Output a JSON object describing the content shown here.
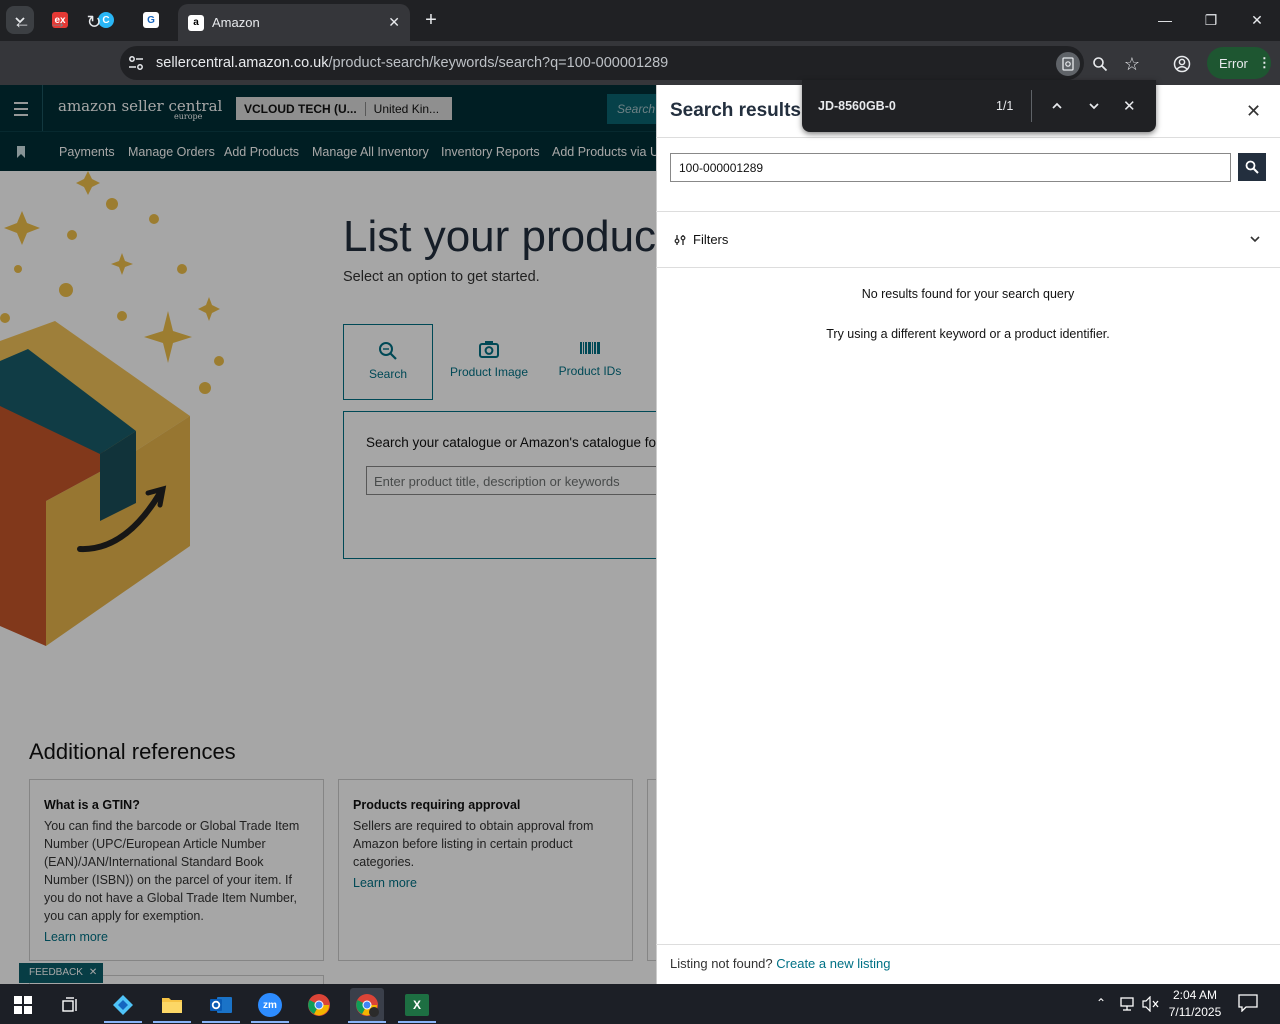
{
  "browser": {
    "active_tab_title": "Amazon",
    "url_host": "sellercentral.amazon.co.uk",
    "url_path": "/product-search/keywords/search?q=100-000001289",
    "error_label": "Error",
    "find": {
      "query": "JD-8560GB-0",
      "count": "1/1"
    }
  },
  "header": {
    "logo_main": "amazon seller central",
    "logo_sub": "europe",
    "account": "VCLOUD TECH (U...",
    "region": "United Kin...",
    "search_placeholder": "Search"
  },
  "nav": {
    "items": [
      "Payments",
      "Manage Orders",
      "Add Products",
      "Manage All Inventory",
      "Inventory Reports",
      "Add Products via Up"
    ]
  },
  "main": {
    "title": "List your products",
    "subtitle": "Select an option to get started.",
    "options": [
      {
        "label": "Search",
        "icon": "search-icon"
      },
      {
        "label": "Product Image",
        "icon": "camera-icon"
      },
      {
        "label": "Product IDs",
        "icon": "barcode-icon"
      }
    ],
    "search_prompt": "Search your catalogue or Amazon's catalogue for a",
    "search_placeholder": "Enter product title, description or keywords"
  },
  "references": {
    "heading": "Additional references",
    "cards": [
      {
        "title": "What is a GTIN?",
        "body": "You can find the barcode or Global Trade Item Number (UPC/European Article Number (EAN)/JAN/International Standard Book Number (ISBN)) on the parcel of your item. If you do not have a Global Trade Item Number, you can apply for exemption.",
        "link": "Learn more"
      },
      {
        "title": "Products requiring approval",
        "body": "Sellers are required to obtain approval from Amazon before listing in certain product categories.",
        "link": "Learn more"
      }
    ],
    "feedback": "FEEDBACK"
  },
  "panel": {
    "title": "Search results",
    "query": "100-000001289",
    "filters_label": "Filters",
    "no_results": "No results found for your search query",
    "hint": "Try using a different keyword or a product identifier.",
    "footer_text": "Listing not found?",
    "footer_link": "Create a new listing"
  },
  "taskbar": {
    "time": "2:04 AM",
    "date": "7/11/2025"
  },
  "colors": {
    "seller_header": "#002f36",
    "panel_accent": "#007185",
    "search_button": "#232f3e"
  }
}
